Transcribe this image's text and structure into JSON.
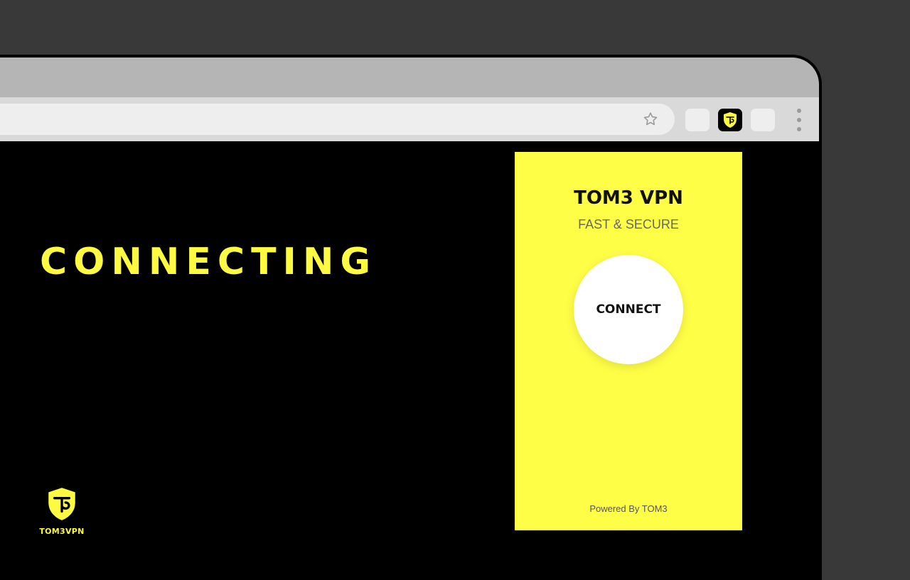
{
  "colors": {
    "background": "#393939",
    "page": "#000000",
    "accent": "#fef941",
    "popup": "#fffe46"
  },
  "browser": {
    "bookmark_icon": "star-outline-icon",
    "extensions": [
      {
        "name": "extension-placeholder-1",
        "active": false
      },
      {
        "name": "tom3-vpn-extension-icon",
        "active": true
      },
      {
        "name": "extension-placeholder-2",
        "active": false
      }
    ],
    "menu_icon": "kebab-menu-icon"
  },
  "page": {
    "headline": "CONNECTING",
    "brand": {
      "logo_icon": "shield-logo-icon",
      "name": "TOM3VPN"
    }
  },
  "popup": {
    "title": "TOM3 VPN",
    "subtitle": "FAST & SECURE",
    "connect_label": "CONNECT",
    "footer": "Powered By TOM3"
  }
}
